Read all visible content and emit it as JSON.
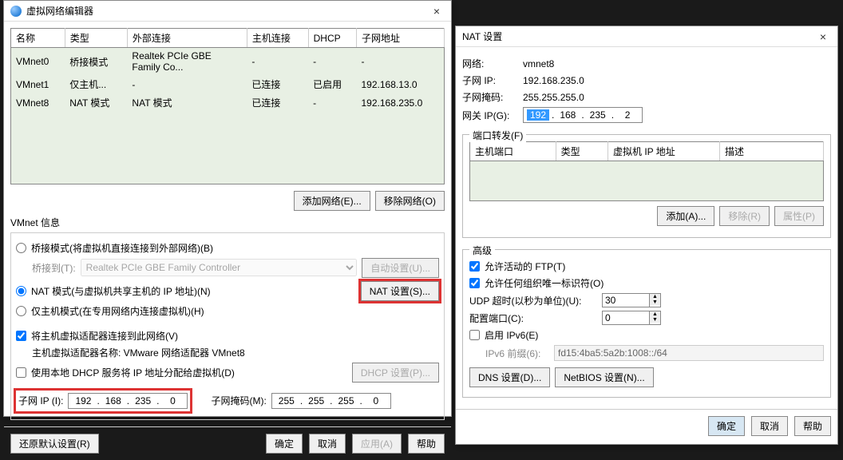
{
  "editor": {
    "title": "虚拟网络编辑器",
    "columns": [
      "名称",
      "类型",
      "外部连接",
      "主机连接",
      "DHCP",
      "子网地址"
    ],
    "rows": [
      {
        "name": "VMnet0",
        "type": "桥接模式",
        "ext": "Realtek PCIe GBE Family Co...",
        "host": "-",
        "dhcp": "-",
        "subnet": "-"
      },
      {
        "name": "VMnet1",
        "type": "仅主机...",
        "ext": "-",
        "host": "已连接",
        "dhcp": "已启用",
        "subnet": "192.168.13.0"
      },
      {
        "name": "VMnet8",
        "type": "NAT 模式",
        "ext": "NAT 模式",
        "host": "已连接",
        "dhcp": "-",
        "subnet": "192.168.235.0"
      }
    ],
    "btn_add": "添加网络(E)...",
    "btn_remove": "移除网络(O)",
    "vmnet_info": "VMnet 信息",
    "radio_bridge": "桥接模式(将虚拟机直接连接到外部网络)(B)",
    "bridge_to": "桥接到(T):",
    "bridge_adapter": "Realtek PCIe GBE Family Controller",
    "btn_auto": "自动设置(U)...",
    "radio_nat": "NAT 模式(与虚拟机共享主机的 IP 地址)(N)",
    "btn_nat": "NAT 设置(S)...",
    "radio_host": "仅主机模式(在专用网络内连接虚拟机)(H)",
    "chk_connect": "将主机虚拟适配器连接到此网络(V)",
    "adapter_name_label": "主机虚拟适配器名称: VMware 网络适配器 VMnet8",
    "chk_dhcp": "使用本地 DHCP 服务将 IP 地址分配给虚拟机(D)",
    "btn_dhcp": "DHCP 设置(P)...",
    "subnet_ip_label": "子网 IP (I):",
    "subnet_ip": [
      "192",
      "168",
      "235",
      "0"
    ],
    "subnet_mask_label": "子网掩码(M):",
    "subnet_mask": [
      "255",
      "255",
      "255",
      "0"
    ],
    "btn_restore": "还原默认设置(R)",
    "btn_ok": "确定",
    "btn_cancel": "取消",
    "btn_apply": "应用(A)",
    "btn_help": "帮助"
  },
  "nat": {
    "title": "NAT 设置",
    "net_label": "网络:",
    "net_val": "vmnet8",
    "subnet_label": "子网 IP:",
    "subnet_val": "192.168.235.0",
    "mask_label": "子网掩码:",
    "mask_val": "255.255.255.0",
    "gw_label": "网关 IP(G):",
    "gw": [
      "192",
      "168",
      "235",
      "2"
    ],
    "pf_title": "端口转发(F)",
    "pf_cols": [
      "主机端口",
      "类型",
      "虚拟机 IP 地址",
      "描述"
    ],
    "btn_add": "添加(A)...",
    "btn_remove": "移除(R)",
    "btn_prop": "属性(P)",
    "adv_title": "高级",
    "chk_ftp": "允许活动的 FTP(T)",
    "chk_org": "允许任何组织唯一标识符(O)",
    "udp_label": "UDP 超时(以秒为单位)(U):",
    "udp_val": "30",
    "cfg_label": "配置端口(C):",
    "cfg_val": "0",
    "chk_ipv6": "启用 IPv6(E)",
    "ipv6_prefix_label": "IPv6 前缀(6):",
    "ipv6_prefix_val": "fd15:4ba5:5a2b:1008::/64",
    "btn_dns": "DNS 设置(D)...",
    "btn_netbios": "NetBIOS 设置(N)...",
    "btn_ok": "确定",
    "btn_cancel": "取消",
    "btn_help": "帮助"
  }
}
